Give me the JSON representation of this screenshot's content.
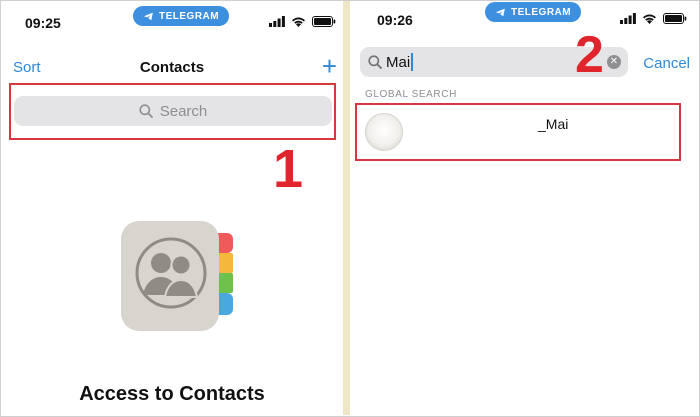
{
  "left": {
    "status": {
      "time": "09:25",
      "telegram": "TELEGRAM"
    },
    "nav": {
      "sort": "Sort",
      "title": "Contacts",
      "add": "+"
    },
    "search": {
      "placeholder": "Search"
    },
    "step": "1",
    "access_title": "Access to Contacts"
  },
  "right": {
    "status": {
      "time": "09:26",
      "telegram": "TELEGRAM"
    },
    "search": {
      "value": "Mai"
    },
    "cancel": "Cancel",
    "step": "2",
    "section_header": "GLOBAL SEARCH",
    "result": {
      "name": "_Mai"
    }
  },
  "colors": {
    "accent": "#2f88d6",
    "highlight": "#d9363e",
    "telegram": "#3d8fe0",
    "step": "#e0252d"
  },
  "icons": [
    "telegram-icon",
    "signal-icon",
    "wifi-icon",
    "battery-icon",
    "plus-icon",
    "search-icon",
    "contacts-book-icon",
    "clear-icon"
  ]
}
